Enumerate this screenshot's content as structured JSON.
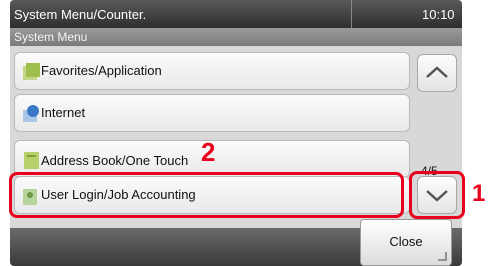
{
  "header": {
    "title": "System Menu/Counter.",
    "clock": "10:10"
  },
  "subheader": {
    "title": "System Menu"
  },
  "menu": {
    "items": [
      {
        "label": "Favorites/Application",
        "icon": "favorites-icon"
      },
      {
        "label": "Internet",
        "icon": "internet-icon"
      },
      {
        "label": "Address Book/One Touch",
        "icon": "address-book-icon"
      },
      {
        "label": "User Login/Job Accounting",
        "icon": "user-login-icon"
      }
    ]
  },
  "pager": {
    "text": "4/5"
  },
  "footer": {
    "close_label": "Close"
  },
  "callouts": {
    "one": "1",
    "two": "2"
  },
  "colors": {
    "highlight": "#e8001c",
    "title_bar": "#3a3a3a"
  }
}
